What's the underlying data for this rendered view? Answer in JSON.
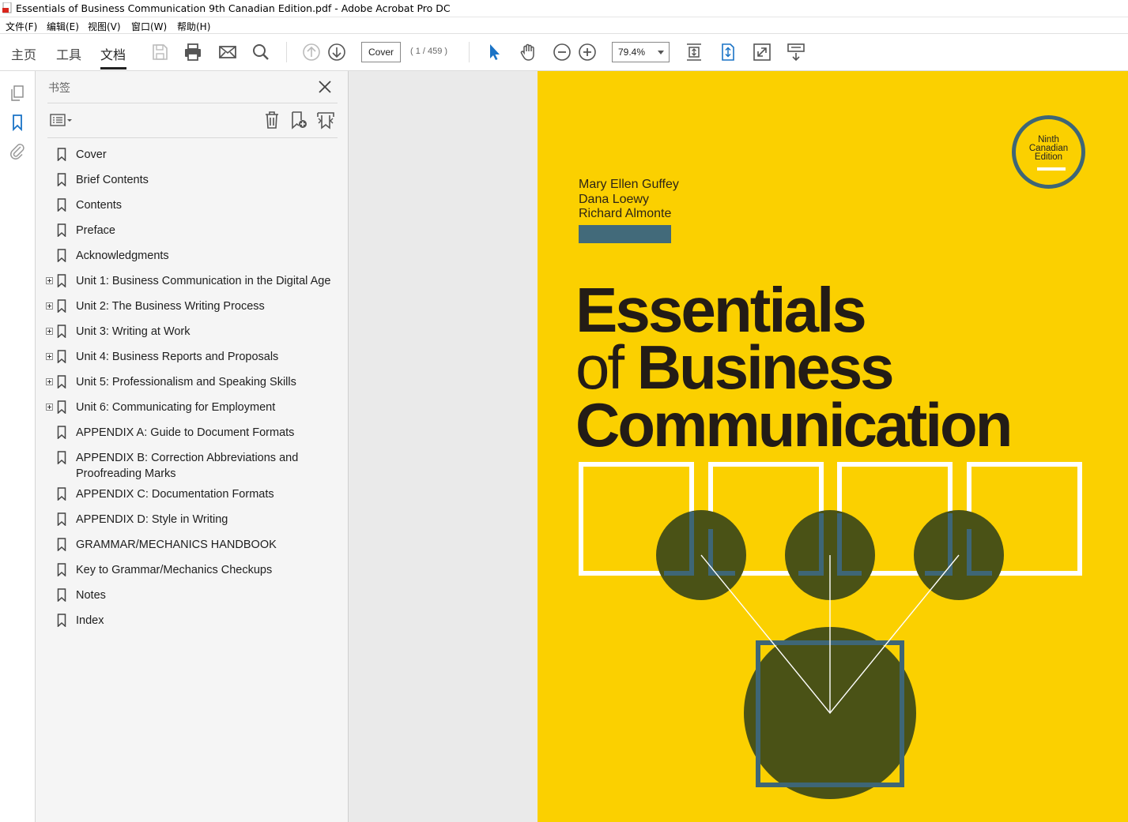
{
  "window": {
    "title": "Essentials of Business Communication 9th Canadian Edition.pdf - Adobe Acrobat Pro DC",
    "app_icon": "acrobat-pdf-icon"
  },
  "menu": [
    "文件(F)",
    "编辑(E)",
    "视图(V)",
    "窗口(W)",
    "帮助(H)"
  ],
  "toolbar": {
    "tabs": [
      "主页",
      "工具",
      "文档"
    ],
    "active_tab": "文档",
    "page_field": "Cover",
    "page_count": "( 1 / 459 )",
    "zoom": "79.4%",
    "icons": [
      "save-icon",
      "print-icon",
      "email-icon",
      "search-icon",
      "prev-page-icon",
      "next-page-icon",
      "select-cursor-icon",
      "hand-tool-icon",
      "zoom-out-icon",
      "zoom-in-icon",
      "scroll-mode-icon",
      "fit-page-icon",
      "full-screen-icon",
      "read-mode-icon"
    ]
  },
  "left_rail": {
    "icons": [
      "page-thumbnails-icon",
      "bookmarks-icon",
      "attachments-icon"
    ]
  },
  "bookmarks_panel": {
    "title": "书签",
    "tools": [
      "options-menu-icon",
      "delete-bookmark-icon",
      "new-bookmark-icon",
      "expand-bookmark-icon"
    ],
    "items": [
      {
        "label": "Cover",
        "expandable": false
      },
      {
        "label": "Brief Contents",
        "expandable": false
      },
      {
        "label": "Contents",
        "expandable": false
      },
      {
        "label": "Preface",
        "expandable": false
      },
      {
        "label": "Acknowledgments",
        "expandable": false
      },
      {
        "label": "Unit 1: Business Communication in the Digital Age",
        "expandable": true
      },
      {
        "label": "Unit 2: The Business Writing Process",
        "expandable": true
      },
      {
        "label": "Unit 3: Writing at Work",
        "expandable": true
      },
      {
        "label": "Unit 4: Business Reports and Proposals",
        "expandable": true
      },
      {
        "label": "Unit 5: Professionalism and Speaking Skills",
        "expandable": true
      },
      {
        "label": "Unit 6: Communicating for Employment",
        "expandable": true
      },
      {
        "label": "APPENDIX A: Guide to Document Formats",
        "expandable": false
      },
      {
        "label": "APPENDIX B: Correction Abbreviations and Proofreading Marks",
        "expandable": false
      },
      {
        "label": "APPENDIX C: Documentation Formats",
        "expandable": false
      },
      {
        "label": "APPENDIX D: Style in Writing",
        "expandable": false
      },
      {
        "label": "GRAMMAR/MECHANICS HANDBOOK",
        "expandable": false
      },
      {
        "label": "Key to Grammar/Mechanics Checkups",
        "expandable": false
      },
      {
        "label": "Notes",
        "expandable": false
      },
      {
        "label": "Index",
        "expandable": false
      }
    ]
  },
  "cover": {
    "authors": [
      "Mary Ellen Guffey",
      "Dana Loewy",
      "Richard Almonte"
    ],
    "edition_badge": [
      "Ninth",
      "Canadian",
      "Edition"
    ],
    "title_line1": "Essentials",
    "title_line2_light": "of",
    "title_line2_bold": "Business",
    "title_line3": "Communication",
    "colors": {
      "background": "#fbd000",
      "circles": "#4a5216",
      "accent": "#3e6676",
      "title": "#231c16"
    }
  }
}
